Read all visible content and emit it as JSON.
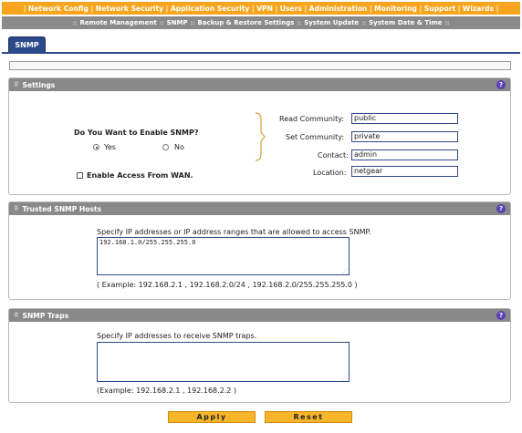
{
  "topnav": {
    "items": [
      "Network Config",
      "Network Security",
      "Application Security",
      "VPN",
      "Users",
      "Administration",
      "Monitoring",
      "Support",
      "Wizards"
    ],
    "active": "Administration"
  },
  "subnav": {
    "items": [
      "Remote Management",
      "SNMP",
      "Backup & Restore Settings",
      "System Update",
      "System Date & Time"
    ],
    "active": "SNMP"
  },
  "tab": {
    "label": "SNMP"
  },
  "settings": {
    "title": "Settings",
    "help_label": "?",
    "enable_question": "Do You Want to Enable SNMP?",
    "yes_label": "Yes",
    "no_label": "No",
    "enable_selected": "Yes",
    "wan_label": "Enable Access From WAN.",
    "wan_checked": false,
    "read_community_label": "Read Community:",
    "read_community_value": "public",
    "set_community_label": "Set Community:",
    "set_community_value": "private",
    "contact_label": "Contact:",
    "contact_value": "admin",
    "location_label": "Location:",
    "location_value": "netgear"
  },
  "trusted": {
    "title": "Trusted SNMP Hosts",
    "help_label": "?",
    "description": "Specify IP addresses or IP address ranges that are allowed to access SNMP.",
    "value": "192.168.1.0/255.255.255.0",
    "example": "( Example: 192.168.2.1 , 192.168.2.0/24 , 192.168.2.0/255.255.255.0 )"
  },
  "traps": {
    "title": "SNMP Traps",
    "help_label": "?",
    "description": "Specify IP addresses to receive SNMP traps.",
    "value": "",
    "example": "(Example: 192.168.2.1 , 192.168.2.2 )"
  },
  "buttons": {
    "apply": "Apply",
    "reset": "Reset"
  },
  "colors": {
    "nav_orange": "#f7a51f",
    "subnav_gray": "#8a8a8a",
    "tab_blue": "#2c4a8a",
    "help_purple": "#5a3fb5",
    "button_orange": "#f7b52a"
  }
}
